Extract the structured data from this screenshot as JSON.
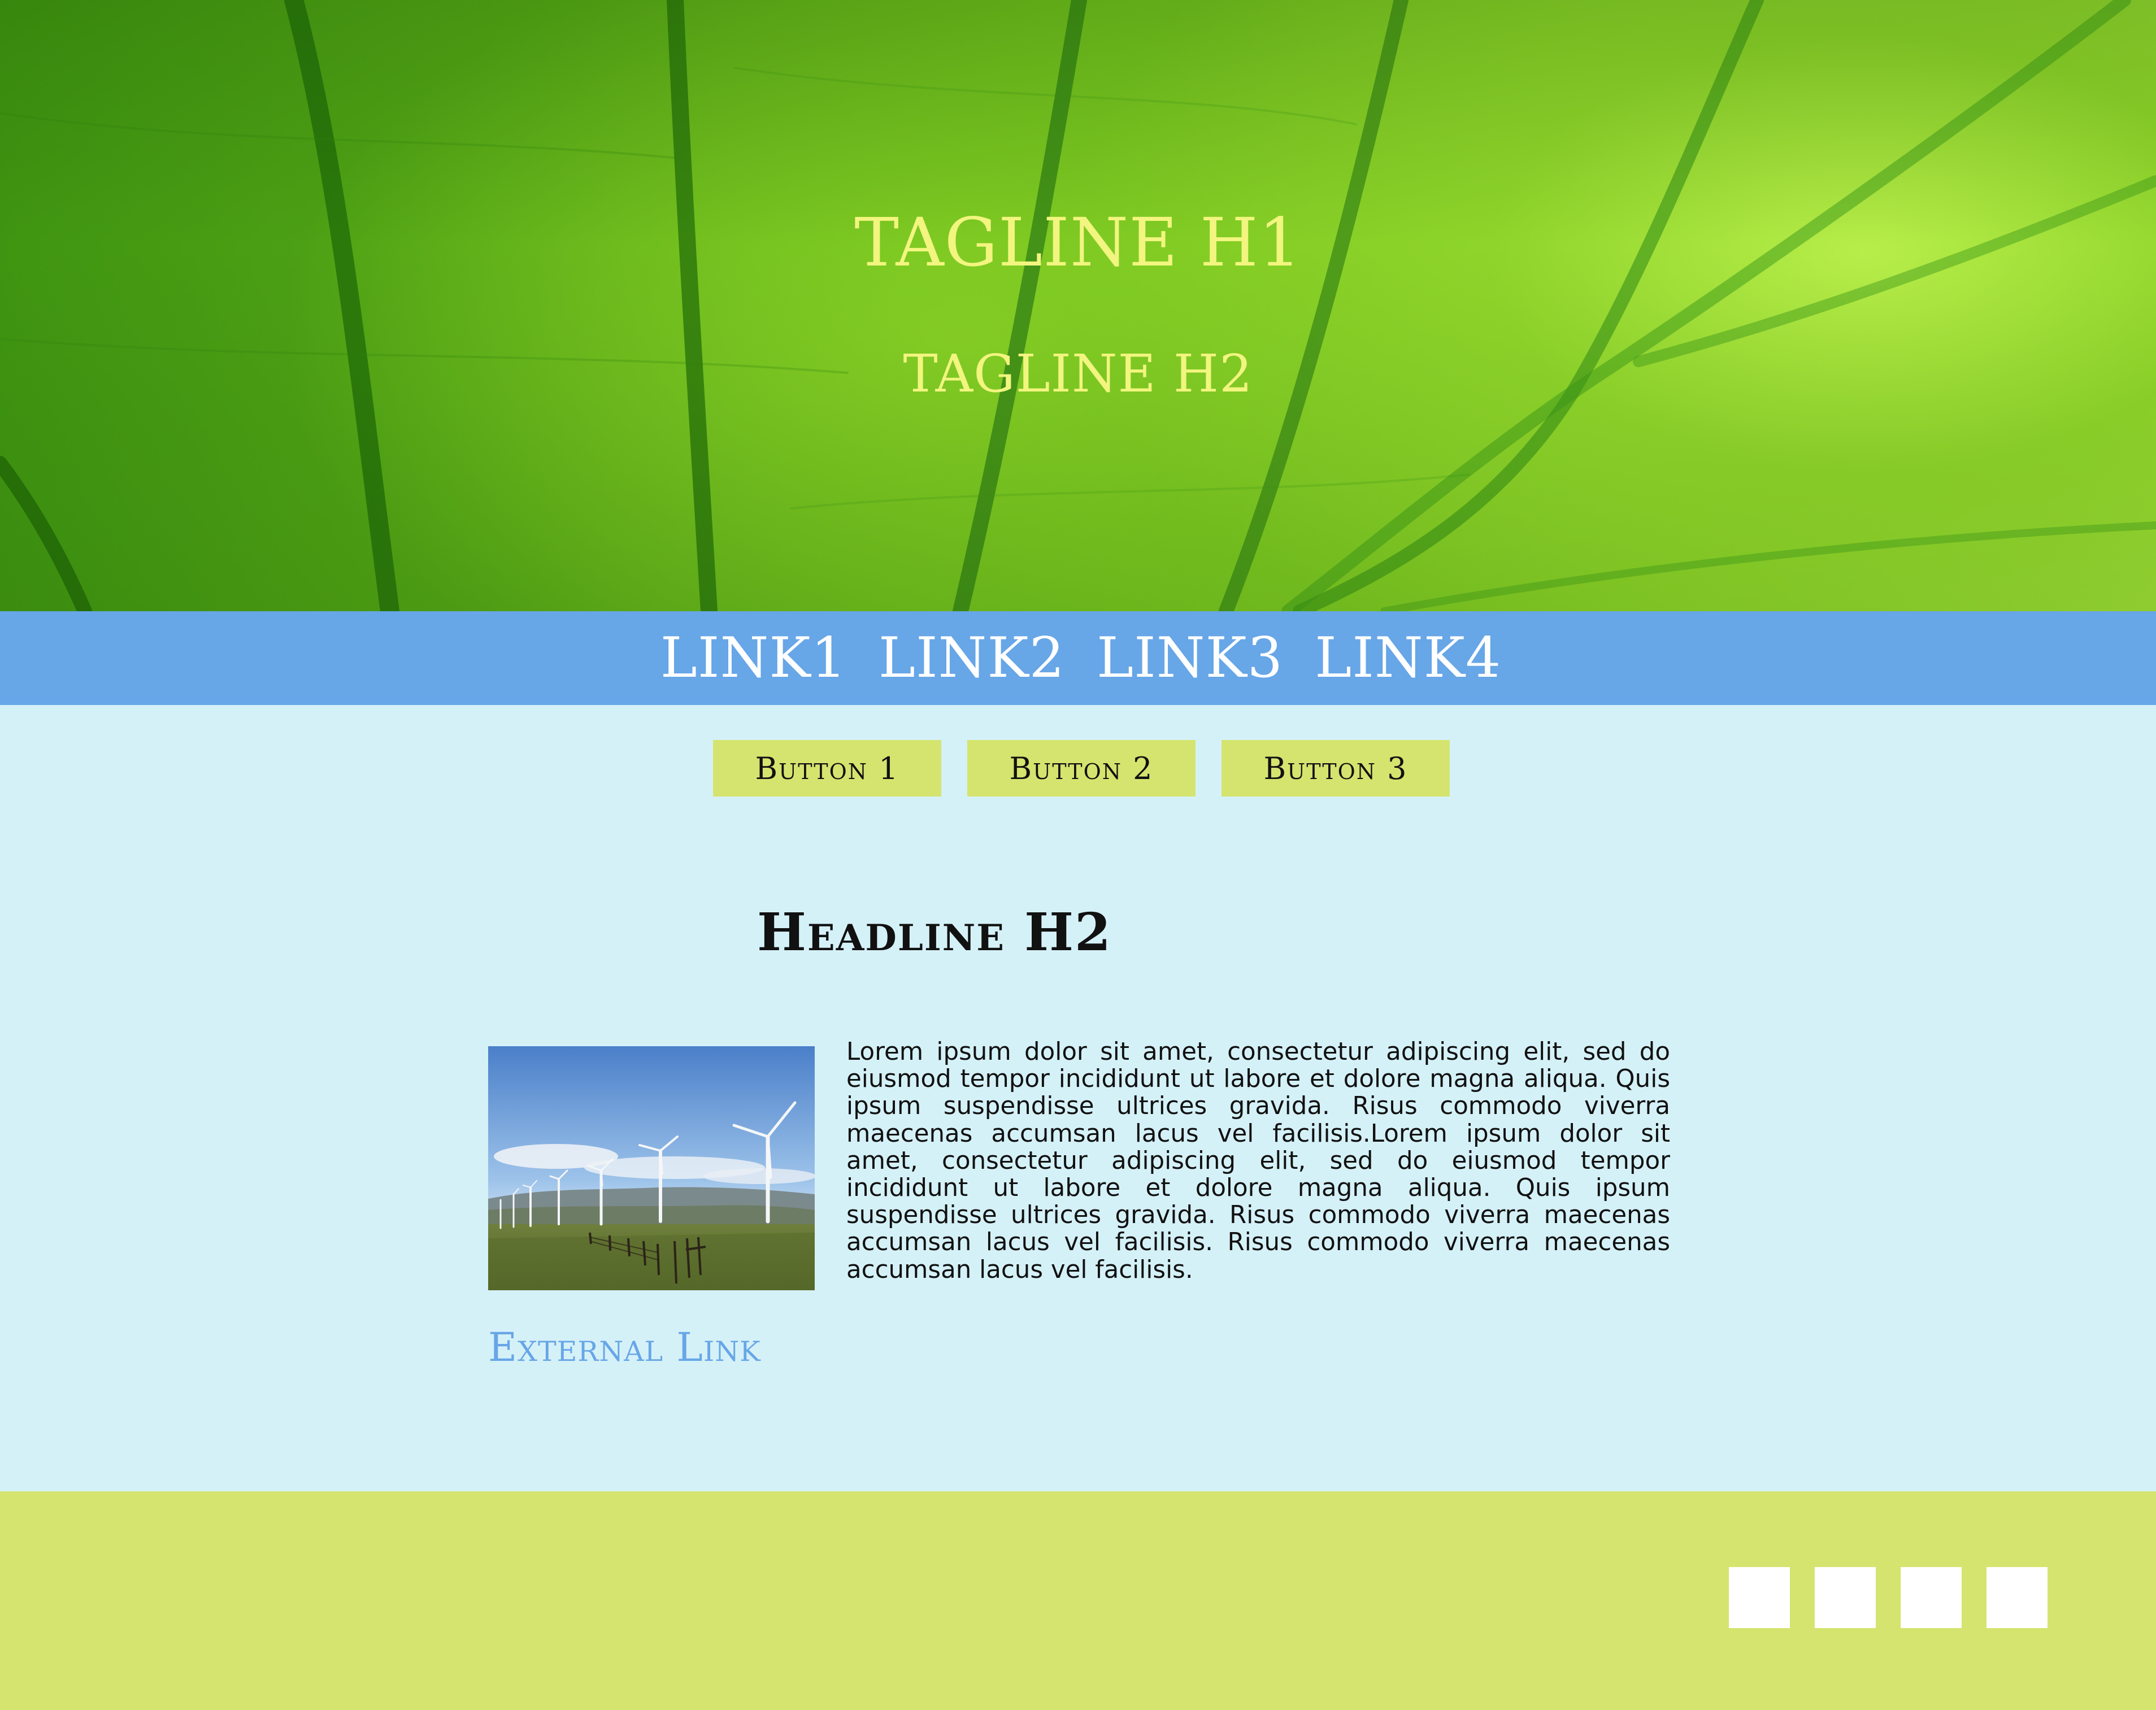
{
  "hero": {
    "tagline_h1": "TAGLINE H1",
    "tagline_h2": "TAGLINE H2"
  },
  "nav": {
    "links": [
      "LINK1",
      "LINK2",
      "LINK3",
      "LINK4"
    ]
  },
  "buttons": [
    "Button 1",
    "Button 2",
    "Button 3"
  ],
  "content": {
    "headline": "Headline H2",
    "image_icon": "wind-turbines-photo",
    "body": "Lorem ipsum dolor sit amet, consectetur adipiscing elit, sed do eiusmod tempor incididunt ut labore et dolore magna aliqua. Quis ipsum suspendisse ultrices gravida. Risus commodo viverra maecenas accumsan lacus vel facilisis.Lorem ipsum dolor sit amet, consectetur adipiscing elit, sed do eiusmod tempor incididunt ut labore et dolore magna aliqua. Quis ipsum suspendisse ultrices gravida. Risus commodo viverra maecenas accumsan lacus vel facilisis. Risus commodo viverra maecenas accumsan lacus vel facilisis.",
    "external_link": "External Link"
  },
  "colors": {
    "nav_bg": "#67a6e7",
    "content_bg": "#d5f1f8",
    "button_bg": "#d5e46e",
    "footer_bg": "#d5e46e",
    "tagline": "#f2f57f",
    "link": "#67a6e7"
  },
  "footer": {
    "social_icons": [
      "social-icon-1",
      "social-icon-2",
      "social-icon-3",
      "social-icon-4"
    ]
  }
}
